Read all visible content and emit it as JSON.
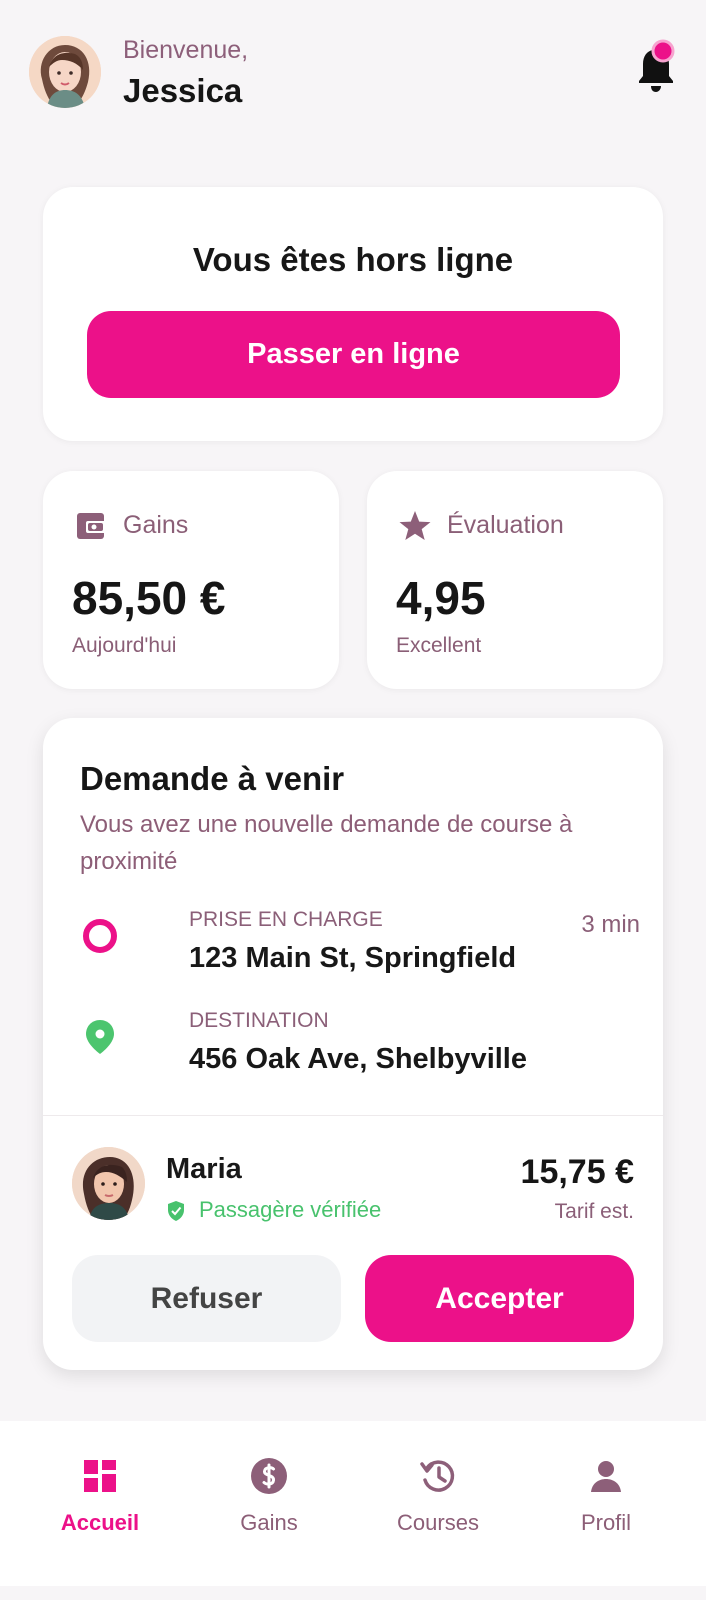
{
  "header": {
    "greeting": "Bienvenue,",
    "user_name": "Jessica",
    "avatar_icon": "woman-avatar",
    "notification_icon": "bell-icon",
    "notification_badge_color": "#ec1189"
  },
  "status_card": {
    "title": "Vous êtes hors ligne",
    "button_label": "Passer en ligne"
  },
  "stats": {
    "earnings": {
      "label": "Gains",
      "value": "85,50 €",
      "subtitle": "Aujourd'hui",
      "icon": "wallet-icon"
    },
    "rating": {
      "label": "Évaluation",
      "value": "4,95",
      "subtitle": "Excellent",
      "icon": "star-icon"
    }
  },
  "request": {
    "title": "Demande à venir",
    "description": "Vous avez une nouvelle demande de course à proximité",
    "pickup": {
      "label": "PRISE EN CHARGE",
      "address": "123 Main St, Springfield",
      "eta": "3 min",
      "icon": "pickup-circle-icon"
    },
    "destination": {
      "label": "DESTINATION",
      "address": "456 Oak Ave, Shelbyville",
      "icon": "map-pin-icon"
    },
    "passenger": {
      "name": "Maria",
      "verified_text": "Passagère vérifiée",
      "verified_icon": "shield-check-icon",
      "avatar_icon": "woman-avatar"
    },
    "fare": {
      "value": "15,75 €",
      "label": "Tarif est."
    },
    "actions": {
      "refuse": "Refuser",
      "accept": "Accepter"
    }
  },
  "bottom_nav": {
    "items": [
      {
        "label": "Accueil",
        "icon": "dashboard-icon",
        "active": true
      },
      {
        "label": "Gains",
        "icon": "dollar-circle-icon",
        "active": false
      },
      {
        "label": "Courses",
        "icon": "history-icon",
        "active": false
      },
      {
        "label": "Profil",
        "icon": "person-icon",
        "active": false
      }
    ]
  },
  "colors": {
    "accent": "#ec1189",
    "muted_text": "#8b5f78",
    "verified_green": "#48c26d",
    "background": "#f7f5f7"
  }
}
